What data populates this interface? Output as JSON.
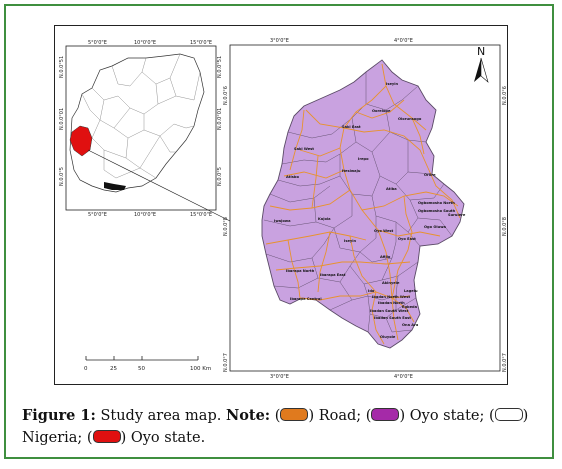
{
  "inset": {
    "top_ticks": [
      "5°0'0\"E",
      "10°0'0\"E",
      "15°0'0\"E"
    ],
    "bottom_ticks": [
      "5°0'0\"E",
      "10°0'0\"E",
      "15°0'0\"E"
    ],
    "left_ticks": [
      "N.0.0°51",
      "N.0.0°01",
      "N.0.0°5"
    ],
    "right_ticks": [
      "N.0.0°51",
      "N.0.0°01",
      "N.0.0°5"
    ]
  },
  "main_map": {
    "top_ticks": [
      "3°0'0\"E",
      "4°0'0\"E"
    ],
    "bottom_ticks": [
      "3°0'0\"E",
      "4°0'0\"E"
    ],
    "left_ticks": [
      "N.0.0°6",
      "N.0.0°8",
      "N.0.0°7"
    ],
    "right_ticks": [
      "N.0.0°6",
      "N.0.0°8",
      "N.0.0°7"
    ],
    "north_label": "N",
    "lga_labels": [
      "Iseyin",
      "Oorelope",
      "Olorunsogo",
      "Saki East",
      "Saki West",
      "Atisbo",
      "Itesiwaju",
      "Irepo",
      "Oriire",
      "Atiba",
      "Ogbomosho North",
      "Ogbomosho South",
      "Surulere",
      "Ogo Oluwa",
      "Iwajowa",
      "Kajola",
      "Iseyin",
      "Oyo West",
      "Oyo East",
      "Afijio",
      "Ibarapa North",
      "Ibarapa East",
      "Ido",
      "Akinyele",
      "Lagelu",
      "Ibarapa Central",
      "Ibadan North West",
      "Ibadan North",
      "Egbeda",
      "Ibadan South West",
      "Ibadan South East",
      "Ona Ara",
      "Oluyole"
    ],
    "colors": {
      "road": "#e8922e",
      "oyo_state": "#c9a2e0",
      "boundary": "#5a4a66"
    }
  },
  "scale_bar": {
    "labels": [
      "0",
      "25",
      "50",
      "100 Km"
    ]
  },
  "caption": {
    "figure_label": "Figure 1:",
    "title": " Study area map. ",
    "note_label": "Note:",
    "road": " Road; (",
    "oyo": " Oyo state; (",
    "nigeria": " Nigeria; (",
    "oyo_red": " Oyo state.",
    "paren_open": " (",
    "paren_close": ")",
    "swatch_colors": {
      "road": "#e07a1e",
      "oyo_state": "#a52aa8",
      "nigeria": "#ffffff",
      "oyo_red": "#e01010"
    }
  }
}
